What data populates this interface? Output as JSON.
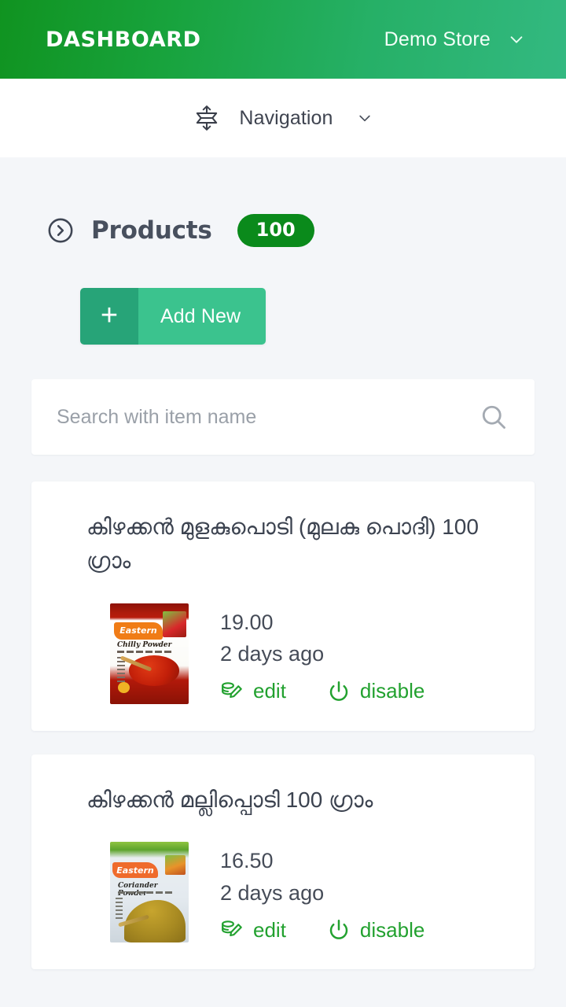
{
  "header": {
    "title": "DASHBOARD",
    "store_name": "Demo Store",
    "chevron_icon": "chevron-down-icon",
    "gradient_start": "#109320",
    "gradient_end": "#33b981"
  },
  "navbar": {
    "label": "Navigation",
    "expand_icon": "expand-vertical-icon",
    "chevron_icon": "chevron-down-icon"
  },
  "section": {
    "title": "Products",
    "count_badge": "100",
    "badge_color": "#0a8a1b",
    "arrow_icon": "chevron-right-circle-icon"
  },
  "add_new": {
    "label": "Add New",
    "plus_glyph": "+",
    "plus_bg": "#27a478",
    "label_bg": "#3bc38e"
  },
  "search": {
    "placeholder": "Search with item name",
    "value": "",
    "icon": "search-icon"
  },
  "actions": {
    "edit_label": "edit",
    "edit_icon": "edit-database-icon",
    "disable_label": "disable",
    "disable_icon": "power-icon",
    "action_color": "#22a12f"
  },
  "products": [
    {
      "name": "കിഴക്കൻ മുളകുപൊടി (മുലകു പൊദി) 100 ഗ്രാം",
      "price": "19.00",
      "updated": "2 days ago",
      "thumbnail_alt": "Eastern Chilly Powder packet",
      "brand": "Eastern",
      "variant": "Chilly Powder"
    },
    {
      "name": "കിഴക്കൻ മല്ലിപ്പൊടി 100 ഗ്രാം",
      "price": "16.50",
      "updated": "2 days ago",
      "thumbnail_alt": "Eastern Coriander Powder packet",
      "brand": "Eastern",
      "variant": "Coriander Powder"
    }
  ]
}
